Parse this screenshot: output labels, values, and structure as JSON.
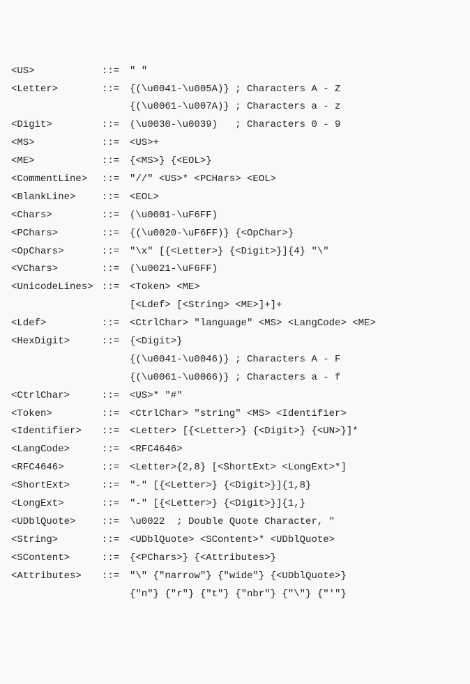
{
  "rules": [
    {
      "lhs": "<US>",
      "op": "::=",
      "rhs": [
        "\" \""
      ]
    },
    {
      "lhs": "<Letter>",
      "op": "::=",
      "rhs": [
        "{(\\u0041-\\u005A)} ; Characters A - Z",
        "{(\\u0061-\\u007A)} ; Characters a - z"
      ]
    },
    {
      "lhs": "<Digit>",
      "op": "::=",
      "rhs": [
        "(\\u0030-\\u0039)   ; Characters 0 - 9"
      ]
    },
    {
      "lhs": "<MS>",
      "op": "::=",
      "rhs": [
        "<US>+"
      ]
    },
    {
      "lhs": "<ME>",
      "op": "::=",
      "rhs": [
        "{<MS>} {<EOL>}"
      ]
    },
    {
      "lhs": "<CommentLine>",
      "op": "::=",
      "rhs": [
        "\"//\" <US>* <PCHars> <EOL>"
      ]
    },
    {
      "lhs": "<BlankLine>",
      "op": "::=",
      "rhs": [
        "<EOL>"
      ]
    },
    {
      "lhs": "<Chars>",
      "op": "::=",
      "rhs": [
        "(\\u0001-\\uF6FF)"
      ]
    },
    {
      "lhs": "<PChars>",
      "op": "::=",
      "rhs": [
        "{(\\u0020-\\uF6FF)} {<OpChar>}"
      ]
    },
    {
      "lhs": "<OpChars>",
      "op": "::=",
      "rhs": [
        "\"\\x\" [{<Letter>} {<Digit>}]{4} \"\\\""
      ]
    },
    {
      "lhs": "<VChars>",
      "op": "::=",
      "rhs": [
        "(\\u0021-\\uF6FF)"
      ]
    },
    {
      "lhs": "<UnicodeLines>",
      "op": "::=",
      "rhs": [
        "<Token> <ME>",
        "[<Ldef> [<String> <ME>]+]+"
      ]
    },
    {
      "lhs": "<Ldef>",
      "op": "::=",
      "rhs": [
        "<CtrlChar> \"language\" <MS> <LangCode> <ME>"
      ]
    },
    {
      "lhs": "<HexDigit>",
      "op": "::=",
      "rhs": [
        "{<Digit>}",
        "{(\\u0041-\\u0046)} ; Characters A - F",
        "{(\\u0061-\\u0066)} ; Characters a - f"
      ]
    },
    {
      "lhs": "<CtrlChar>",
      "op": "::=",
      "rhs": [
        "<US>* \"#\""
      ]
    },
    {
      "lhs": "<Token>",
      "op": "::=",
      "rhs": [
        "<CtrlChar> \"string\" <MS> <Identifier>"
      ]
    },
    {
      "lhs": "<Identifier>",
      "op": "::=",
      "rhs": [
        "<Letter> [{<Letter>} {<Digit>} {<UN>}]*"
      ]
    },
    {
      "lhs": "<LangCode>",
      "op": "::=",
      "rhs": [
        "<RFC4646>"
      ]
    },
    {
      "lhs": "<RFC4646>",
      "op": "::=",
      "rhs": [
        "<Letter>{2,8} [<ShortExt> <LongExt>*]"
      ]
    },
    {
      "lhs": "<ShortExt>",
      "op": "::=",
      "rhs": [
        "\"-\" [{<Letter>} {<Digit>}]{1,8}"
      ]
    },
    {
      "lhs": "<LongExt>",
      "op": "::=",
      "rhs": [
        "\"-\" [{<Letter>} {<Digit>}]{1,}"
      ]
    },
    {
      "lhs": "<UDblQuote>",
      "op": "::=",
      "rhs": [
        "\\u0022  ; Double Quote Character, \""
      ]
    },
    {
      "lhs": "<String>",
      "op": "::=",
      "rhs": [
        "<UDblQuote> <SContent>* <UDblQuote>"
      ]
    },
    {
      "lhs": "<SContent>",
      "op": "::=",
      "rhs": [
        "{<PChars>} {<Attributes>}"
      ]
    },
    {
      "lhs": "<Attributes>",
      "op": "::=",
      "rhs": [
        "\"\\\" {\"narrow\"} {\"wide\"} {<UDblQuote>}",
        "{\"n\"} {\"r\"} {\"t\"} {\"nbr\"} {\"\\\"} {\"'\"}"
      ]
    }
  ]
}
